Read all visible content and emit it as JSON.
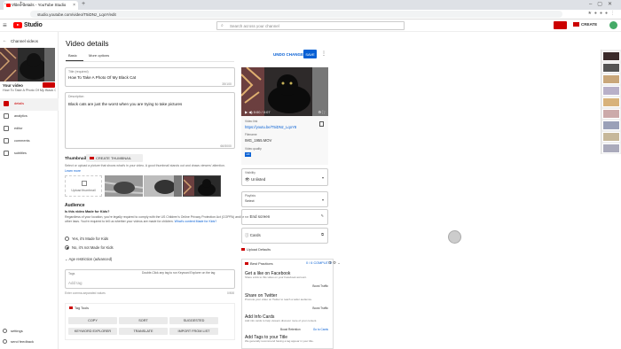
{
  "browser": {
    "tab_title": "Video details - YouTube Studio",
    "url": "studio.youtube.com/video/T5iDNz_LqoY/edit"
  },
  "header": {
    "logo_text": "Studio",
    "search_placeholder": "Search across your channel",
    "create_label": "CREATE"
  },
  "sidebar": {
    "back_label": "Channel videos",
    "your_video": "Your video",
    "video_title": "How To Take A Photo Of My Black Cat",
    "items": [
      {
        "label": "details",
        "icon": "pencil-icon"
      },
      {
        "label": "analytics",
        "icon": "chart-icon"
      },
      {
        "label": "editor",
        "icon": "film-icon"
      },
      {
        "label": "comments",
        "icon": "comment-icon"
      },
      {
        "label": "subtitles",
        "icon": "subtitles-icon"
      }
    ],
    "settings": "settings",
    "feedback": "send feedback"
  },
  "main": {
    "page_title": "Video details",
    "tabs": [
      "Basic",
      "More options"
    ],
    "undo": "UNDO CHANGES",
    "save": "SAVE",
    "title_field": {
      "label": "Title (required)",
      "value": "How To Take A Photo Of My Black Cat",
      "count": "35/100"
    },
    "desc_field": {
      "label": "Description",
      "value": "Black cats are just the worst when you are trying to take pictures",
      "count": "66/5000"
    },
    "thumbnail": {
      "title": "Thumbnail",
      "create_button": "CREATE THUMBNAIL",
      "description": "Select or upload a picture that shows what's in your video. A good thumbnail stands out and draws viewers' attention.",
      "learn_more": "Learn more",
      "upload_label": "Upload thumbnail"
    },
    "audience": {
      "title": "Audience",
      "question": "Is this video Made for Kids?",
      "description": "Regardless of your location, you're legally required to comply with the US Children's Online Privacy Protection Act (COPPA) and/or other laws. You're required to tell us whether your videos are made for children.",
      "link": "What's content Made for Kids?",
      "option_yes": "Yes, it's Made for Kids",
      "option_no": "No, it's not Made for Kids",
      "age_restriction": "Age restriction (advanced)"
    },
    "tags": {
      "label": "Tags",
      "placeholder": "Add tag",
      "top_note": "Double-Click any tag to run Keyword Explorer on the tag",
      "note": "Enter comma-separated values",
      "count": "0/500"
    },
    "tag_tools": {
      "title": "Tag Tools",
      "buttons": [
        "COPY",
        "SORT",
        "SUGGESTED",
        "KEYWORD EXPLORER",
        "TRANSLATE",
        "IMPORT FROM LIST"
      ]
    }
  },
  "right": {
    "time": "0:00 / 0:07",
    "video_link_label": "Video link",
    "video_link": "https://youtu.be/T5iDNz_LqoY8",
    "filename_label": "Filename",
    "filename": "IMG_1955.MOV",
    "quality_label": "Video quality",
    "quality": "HD",
    "visibility_label": "Visibility",
    "visibility": "Unlisted",
    "playlists_label": "Playlists",
    "playlists": "Select",
    "end_screen": "End screen",
    "cards": "Cards",
    "upload_defaults": "Upload Defaults",
    "best_practices": {
      "title": "Best Practices",
      "count": "0 / 6 COMPLETE",
      "items": [
        {
          "title": "Get a like on Facebook",
          "desc": "Share a link to this video on your Facebook account.",
          "badge": "Boost Traffic"
        },
        {
          "title": "Share on Twitter",
          "desc": "Promote your video on Twitter to reach a wider audience.",
          "badge": "Boost Traffic"
        },
        {
          "title": "Add Info Cards",
          "desc": "Add info cards to help viewers discover more of your content.",
          "badge": "Boost Retention",
          "badge2": "Go to Cards"
        },
        {
          "title": "Add Tags to your Title",
          "desc": "We generally recommend having a tag appear in your title."
        }
      ]
    }
  },
  "colors": {
    "brand": "#ff0000",
    "accent": "#065fd4"
  }
}
